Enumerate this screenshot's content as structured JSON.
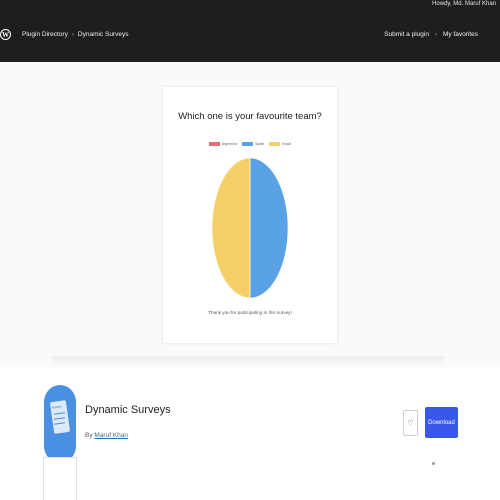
{
  "header": {
    "howdy": "Howdy, Md. Maruf Khan",
    "logo_icon": "wordpress-logo-icon",
    "breadcrumb": [
      {
        "label": "Plugin Directory"
      },
      {
        "label": "Dynamic Surveys"
      }
    ],
    "nav": {
      "submit": "Submit a plugin",
      "favorites": "My favorites"
    }
  },
  "banner": {
    "title": "Which one is your favourite team?",
    "legend": [
      {
        "label": "Argentina",
        "color": "#e66f7c"
      },
      {
        "label": "Spain",
        "color": "#5aa2e6"
      },
      {
        "label": "Brazil",
        "color": "#f7cf68"
      }
    ],
    "thanks": "Thank you for participating in this survey!"
  },
  "chart_data": {
    "type": "pie",
    "categories": [
      "Argentina",
      "Spain",
      "Brazil"
    ],
    "values": [
      0,
      50,
      50
    ],
    "colors": [
      "#e66f7c",
      "#5aa2e6",
      "#f7cf68"
    ],
    "title": "Which one is your favourite team?"
  },
  "plugin": {
    "name": "Dynamic Surveys",
    "by_prefix": "By",
    "author": "Maruf Khan",
    "download_label": "Download",
    "favorite_icon": "heart-icon",
    "icon_label": "Survey"
  }
}
